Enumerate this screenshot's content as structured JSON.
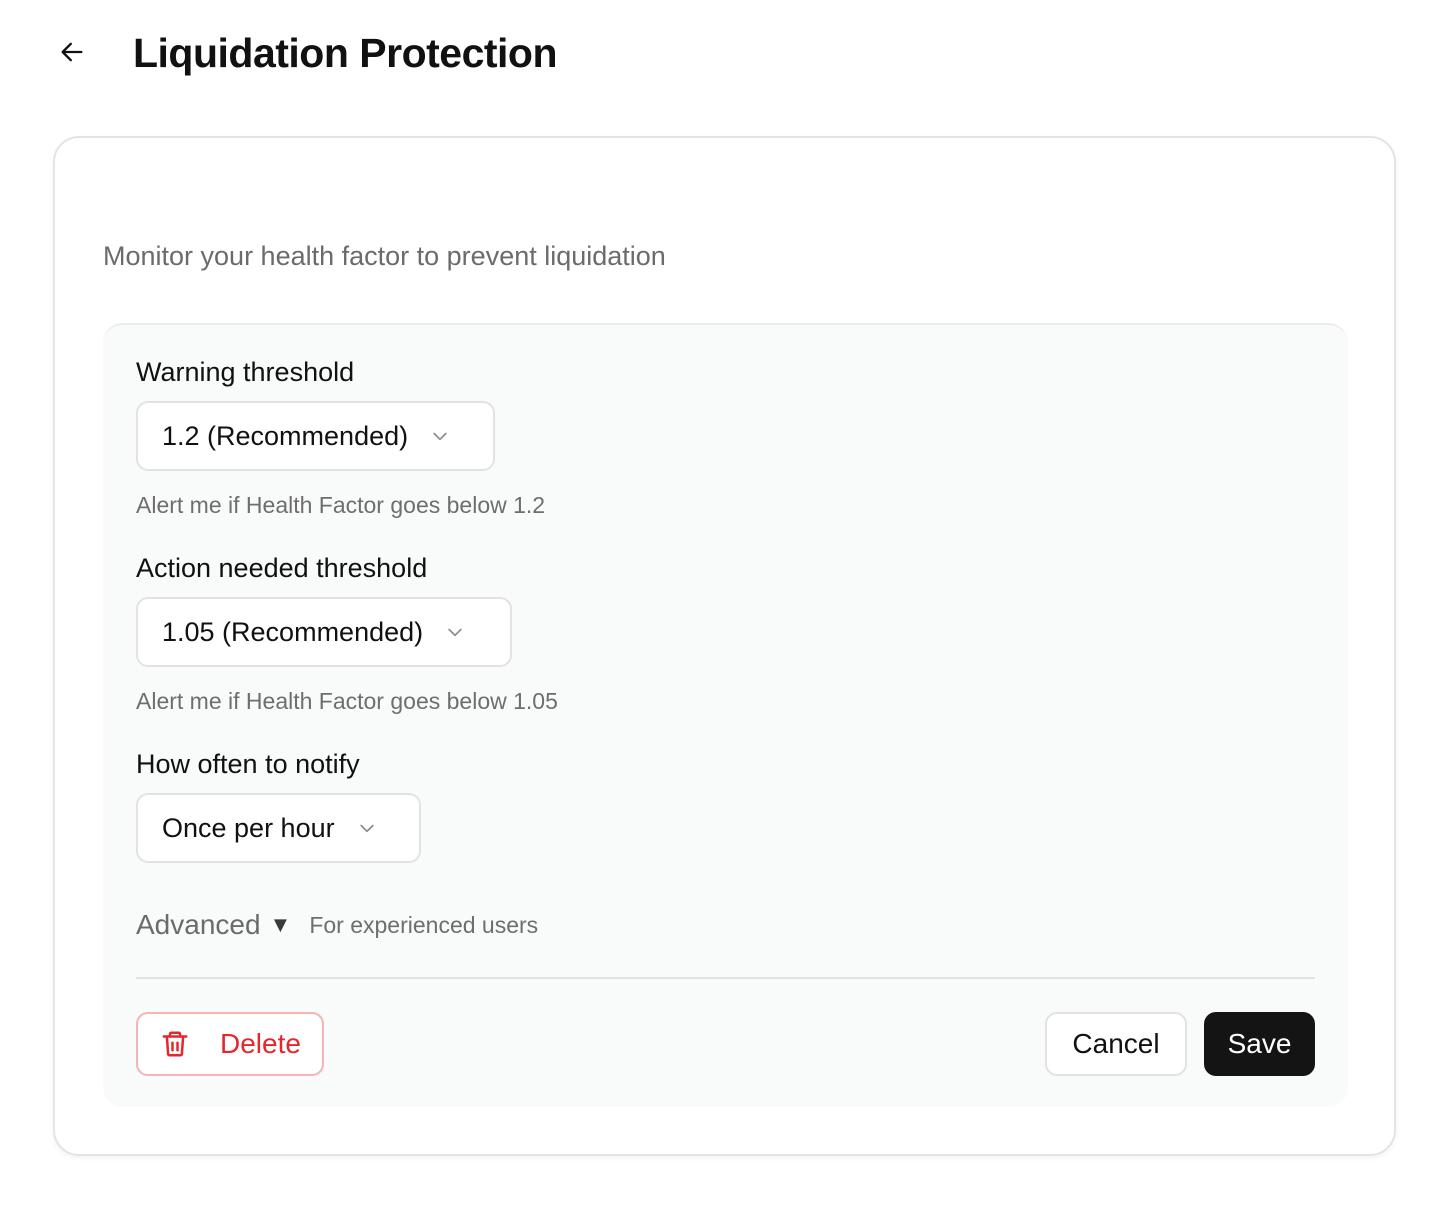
{
  "header": {
    "back_icon": "arrow-left-icon",
    "title": "Liquidation Protection"
  },
  "card": {
    "subtitle": "Monitor your health factor to prevent liquidation"
  },
  "form": {
    "warning": {
      "label": "Warning threshold",
      "selected": "1.2 (Recommended)",
      "hint": "Alert me if Health Factor goes below 1.2"
    },
    "action": {
      "label": "Action needed threshold",
      "selected": "1.05 (Recommended)",
      "hint": "Alert me if Health Factor goes below 1.05"
    },
    "frequency": {
      "label": "How often to notify",
      "selected": "Once per hour"
    },
    "advanced": {
      "label": "Advanced",
      "toggle_glyph": "▼",
      "note": "For experienced users"
    }
  },
  "actions": {
    "delete_label": "Delete",
    "cancel_label": "Cancel",
    "save_label": "Save"
  },
  "colors": {
    "danger": "#e5262c",
    "primary_button": "#141414",
    "panel_bg": "#f9fafa",
    "muted_text": "#6b6b6b"
  }
}
